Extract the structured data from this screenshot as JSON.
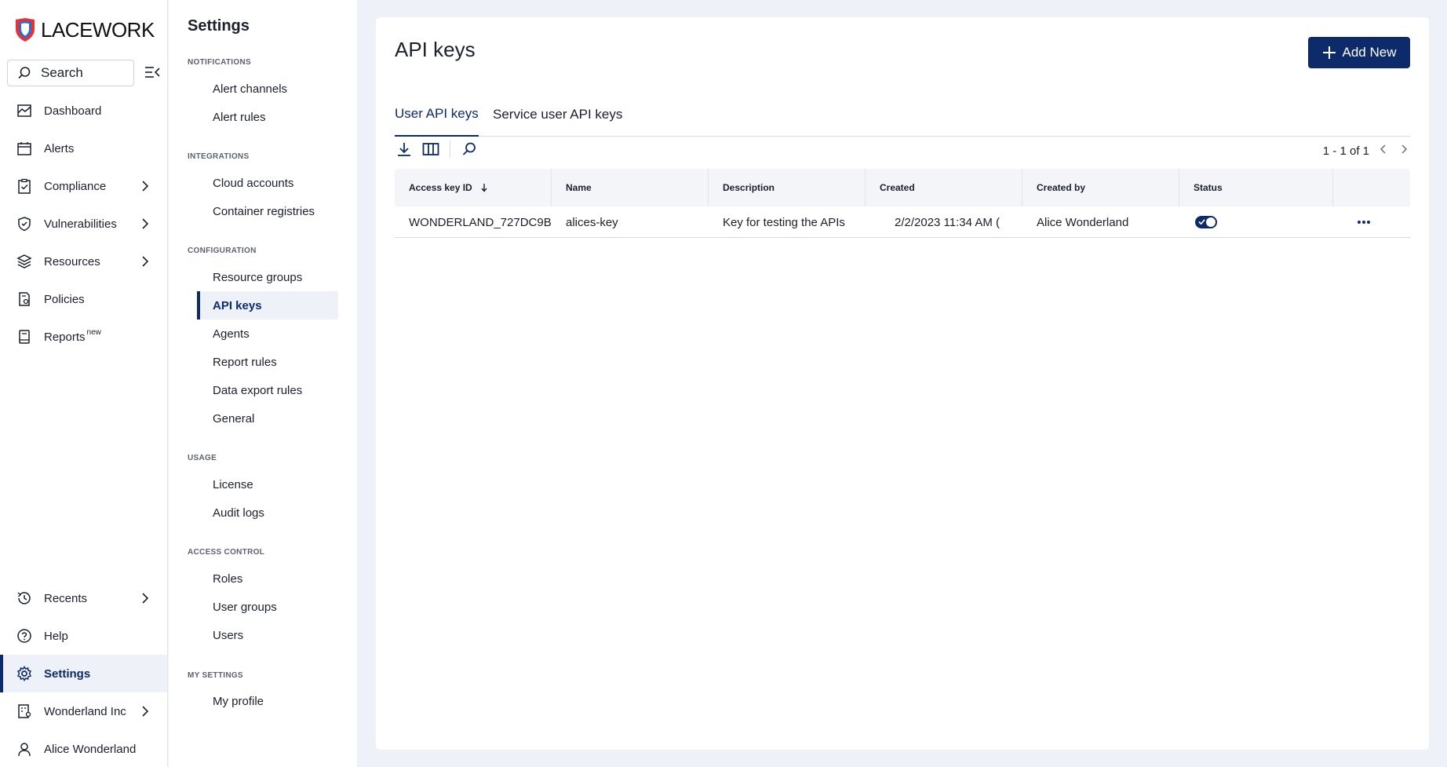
{
  "brand": {
    "name": "LACEWORK",
    "accent": "#0d2a6b",
    "logo_red": "#e8322f",
    "logo_blue": "#2a6bd8"
  },
  "nav": {
    "search_label": "Search",
    "items": [
      {
        "label": "Dashboard",
        "icon": "dashboard-icon"
      },
      {
        "label": "Alerts",
        "icon": "calendar-alert-icon"
      },
      {
        "label": "Compliance",
        "icon": "clipboard-check-icon"
      },
      {
        "label": "Vulnerabilities",
        "icon": "shield-check-icon"
      },
      {
        "label": "Resources",
        "icon": "layers-icon"
      },
      {
        "label": "Policies",
        "icon": "policy-document-icon"
      },
      {
        "label": "Reports",
        "badge": "new",
        "icon": "report-book-icon"
      }
    ],
    "bottom_items": [
      {
        "label": "Recents",
        "icon": "history-icon"
      },
      {
        "label": "Help",
        "icon": "help-circle-icon"
      },
      {
        "label": "Settings",
        "icon": "gear-icon"
      },
      {
        "label": "Wonderland Inc",
        "icon": "organization-icon"
      },
      {
        "label": "Alice Wonderland",
        "icon": "user-icon"
      }
    ]
  },
  "settings": {
    "title": "Settings",
    "sections": [
      {
        "head": "NOTIFICATIONS",
        "items": [
          "Alert channels",
          "Alert rules"
        ]
      },
      {
        "head": "INTEGRATIONS",
        "items": [
          "Cloud accounts",
          "Container registries"
        ]
      },
      {
        "head": "CONFIGURATION",
        "items": [
          "Resource groups",
          "API keys",
          "Agents",
          "Report rules",
          "Data export rules",
          "General"
        ]
      },
      {
        "head": "USAGE",
        "items": [
          "License",
          "Audit logs"
        ]
      },
      {
        "head": "ACCESS CONTROL",
        "items": [
          "Roles",
          "User groups",
          "Users"
        ]
      },
      {
        "head": "MY SETTINGS",
        "items": [
          "My profile"
        ]
      }
    ]
  },
  "main": {
    "title": "API keys",
    "add_button": "Add New",
    "tabs": [
      "User API keys",
      "Service user API keys"
    ],
    "pager": "1 - 1 of 1",
    "columns": [
      "Access key ID",
      "Name",
      "Description",
      "Created",
      "Created by",
      "Status"
    ],
    "rows": [
      {
        "access_key_id": "WONDERLAND_727DC9B",
        "name": "alices-key",
        "description": "Key for testing the APIs",
        "created": "2/2/2023 11:34 AM (",
        "created_by": "Alice Wonderland",
        "status": "enabled"
      }
    ]
  }
}
